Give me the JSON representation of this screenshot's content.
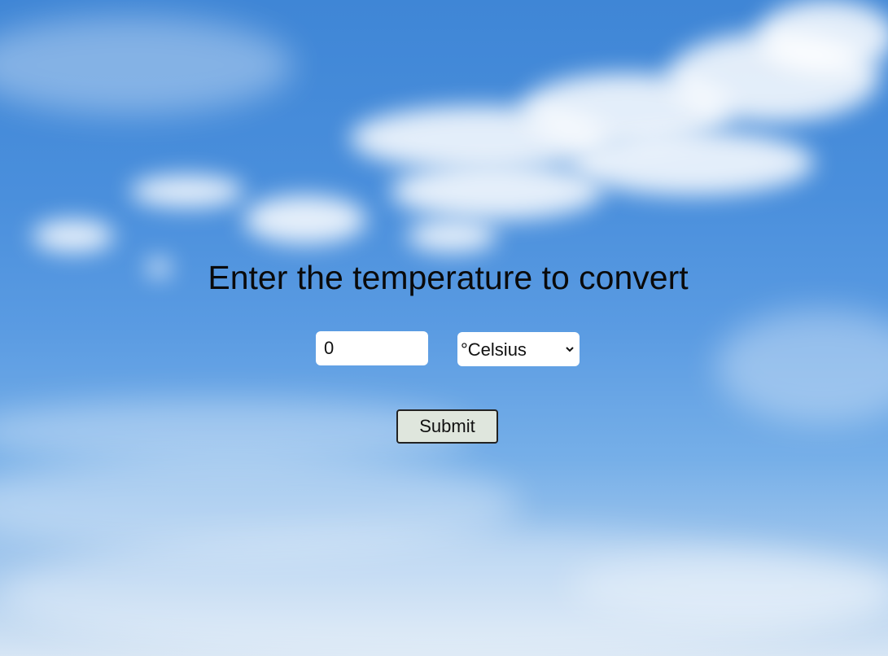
{
  "heading": "Enter the temperature to convert",
  "temperature_input": {
    "value": "0"
  },
  "unit_select": {
    "selected": "°Celsius"
  },
  "submit_label": "Submit",
  "colors": {
    "sky_top": "#3f86d6",
    "sky_bottom": "#d6e5f4",
    "button_bg": "#dfe6dd",
    "text": "#0a0a0a"
  }
}
